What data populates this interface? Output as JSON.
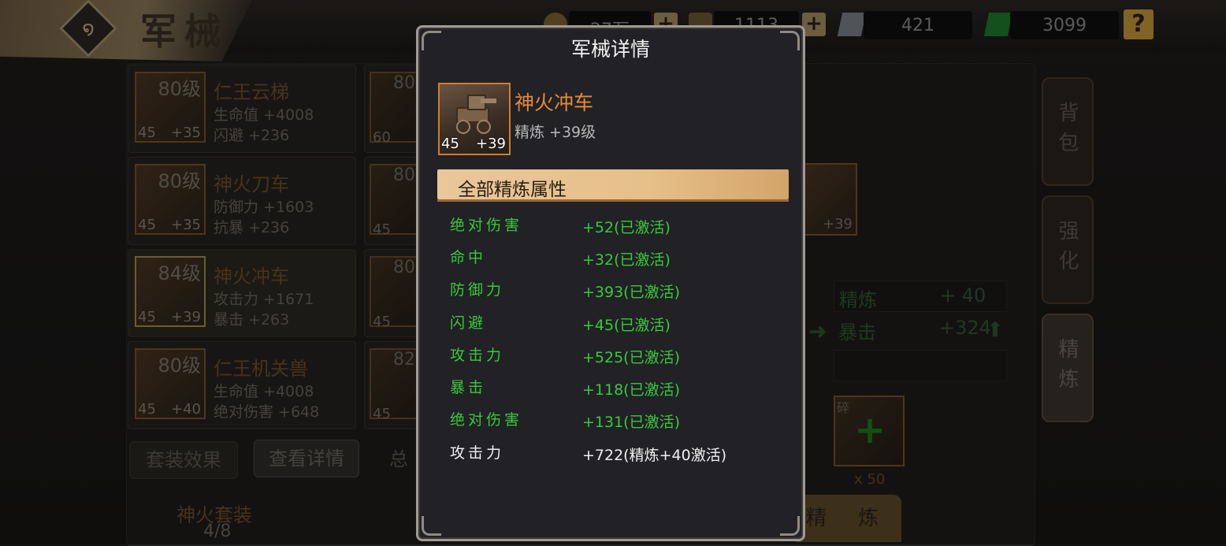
{
  "screen": {
    "title": "军械",
    "resources": [
      {
        "name": "gold",
        "value": "27万",
        "icon": "coin-icon",
        "color": "#c79b3b"
      },
      {
        "name": "food",
        "value": "1113",
        "icon": "grain-icon",
        "color": "#c6a54c"
      },
      {
        "name": "iron",
        "value": "421",
        "icon": "iron-icon",
        "color": "#b9c0c8"
      },
      {
        "name": "jade",
        "value": "3099",
        "icon": "jade-icon",
        "color": "#34b34a"
      }
    ],
    "help_label": "?"
  },
  "equipment_list": [
    {
      "level": "80级",
      "name": "仁王云梯",
      "attr1": "生命值 +4008",
      "attr2": "闪避 +236",
      "star": "45",
      "refine": "+35"
    },
    {
      "level": "80级",
      "name": "神火刀车",
      "attr1": "防御力 +1603",
      "attr2": "抗暴 +236",
      "star": "45",
      "refine": "+35"
    },
    {
      "level": "84级",
      "name": "神火冲车",
      "attr1": "攻击力 +1671",
      "attr2": "暴击 +263",
      "star": "45",
      "refine": "+39"
    },
    {
      "level": "80级",
      "name": "仁王机关兽",
      "attr1": "生命值 +4008",
      "attr2": "绝对伤害 +648",
      "star": "45",
      "refine": "+40"
    }
  ],
  "equipment_list_col2": [
    {
      "level": "80",
      "star": "60"
    },
    {
      "level": "80",
      "star": "45"
    },
    {
      "level": "80",
      "star": "45"
    },
    {
      "level": "82",
      "star": "45"
    }
  ],
  "bottom_buttons": {
    "set_effect": "套装效果",
    "view_details": "查看详情",
    "total": "总"
  },
  "set_info": {
    "name": "神火套装",
    "count": "4/8"
  },
  "side_tabs": [
    "背包",
    "强化",
    "精炼"
  ],
  "refine_panel": {
    "thumb_refine": "+39",
    "stat1_label": "精炼",
    "stat1_value": "+ 40",
    "stat2_label": "暴击",
    "stat2_value": "+324",
    "fragment_label": "碎",
    "fragment_count": "x 50",
    "refine_button": "精 炼"
  },
  "modal": {
    "title": "军械详情",
    "item": {
      "name": "神火冲车",
      "subtitle": "精炼 +39级",
      "star": "45",
      "refine": "+39",
      "name_color": "#e58a34"
    },
    "section_title": "全部精炼属性",
    "attributes": [
      {
        "name": "绝对伤害",
        "value": "+52(已激活)",
        "active": true
      },
      {
        "name": "命中",
        "value": "+32(已激活)",
        "active": true
      },
      {
        "name": "防御力",
        "value": "+393(已激活)",
        "active": true
      },
      {
        "name": "闪避",
        "value": "+45(已激活)",
        "active": true
      },
      {
        "name": "攻击力",
        "value": "+525(已激活)",
        "active": true
      },
      {
        "name": "暴击",
        "value": "+118(已激活)",
        "active": true
      },
      {
        "name": "绝对伤害",
        "value": "+131(已激活)",
        "active": true
      },
      {
        "name": "攻击力",
        "value": "+722(精炼+40激活)",
        "active": false
      }
    ],
    "active_color": "#39c93a",
    "inactive_color": "#f0f0f0"
  }
}
